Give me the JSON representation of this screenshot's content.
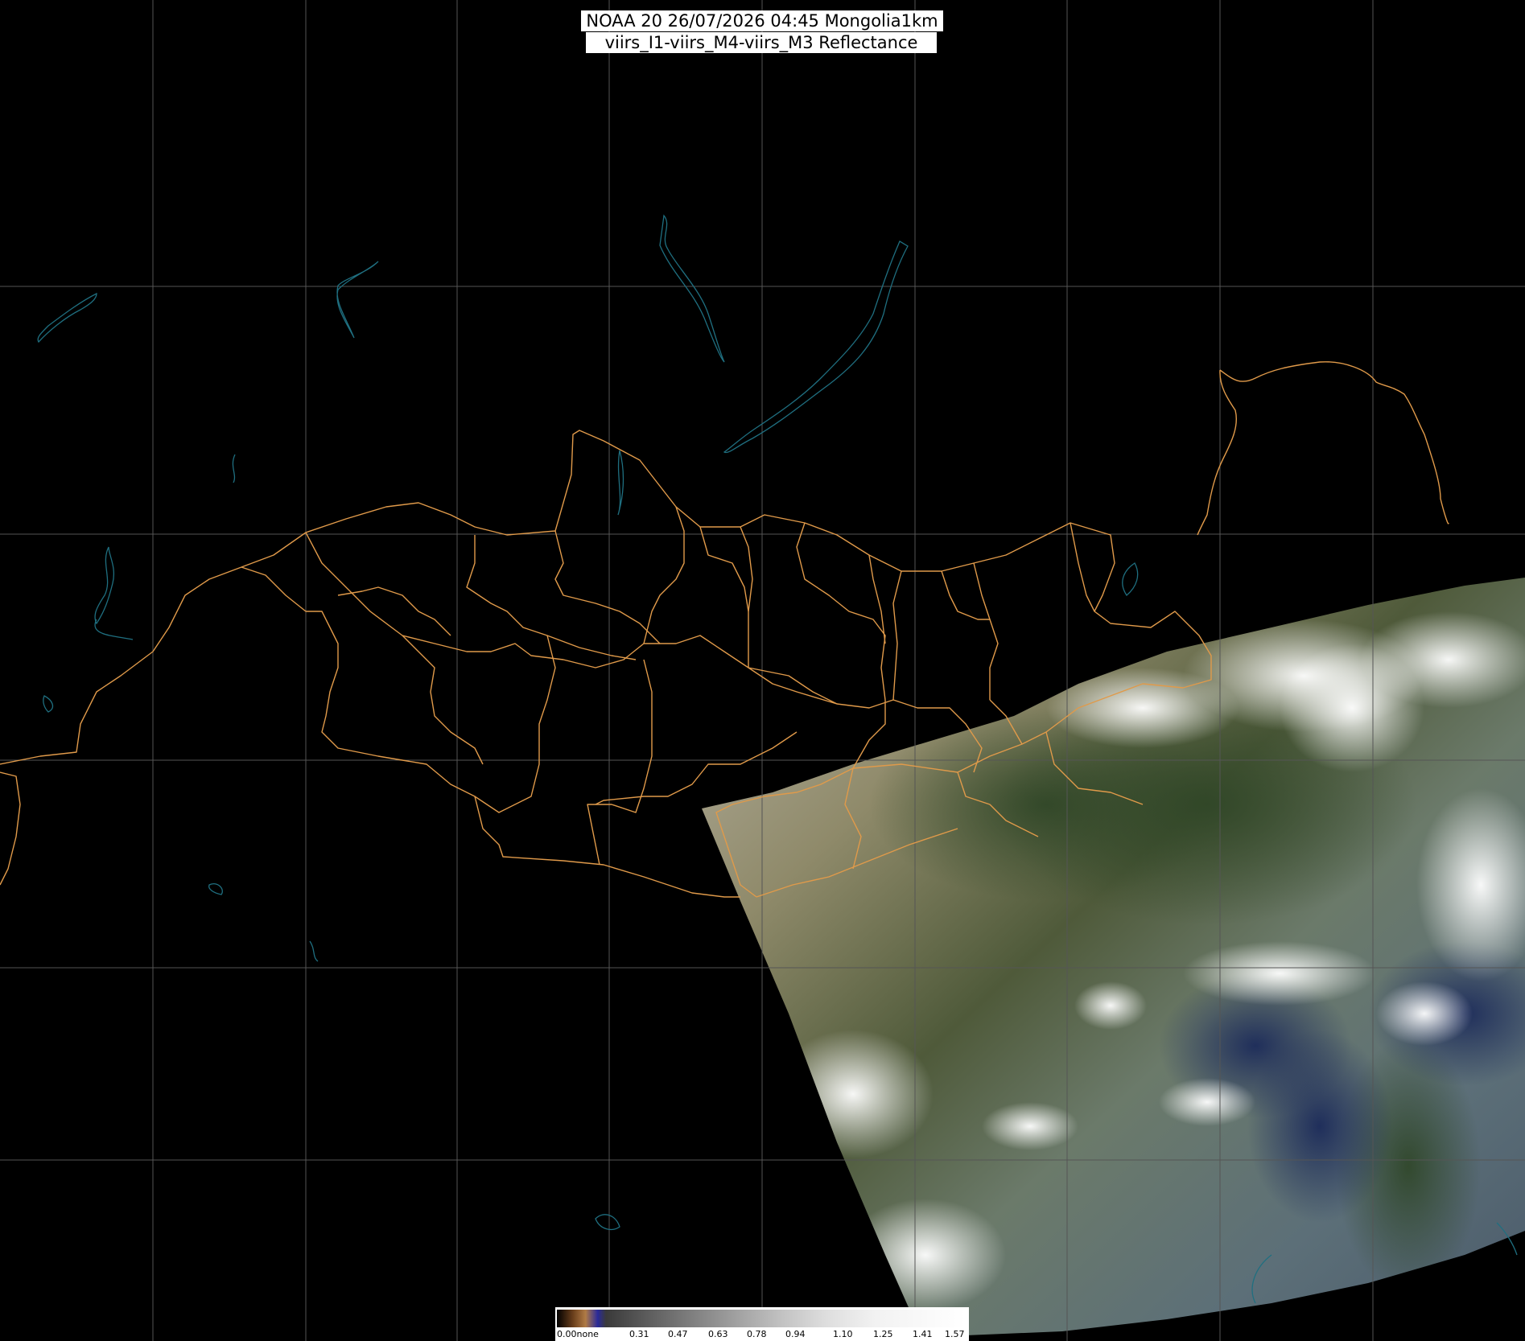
{
  "title": {
    "line1": "NOAA 20 26/07/2026 04:45 Mongolia1km",
    "line2": "viirs_I1-viirs_M4-viirs_M3 Reflectance"
  },
  "colorbar": {
    "ticks": [
      "0.00none",
      "0.31",
      "0.47",
      "0.63",
      "0.78",
      "0.94",
      "1.10",
      "1.25",
      "1.41",
      "1.57"
    ]
  },
  "colors": {
    "background": "#000000",
    "grid": "#555555",
    "borders": "#e09a4a",
    "water": "#1f6f80",
    "title_bg": "#ffffff"
  }
}
